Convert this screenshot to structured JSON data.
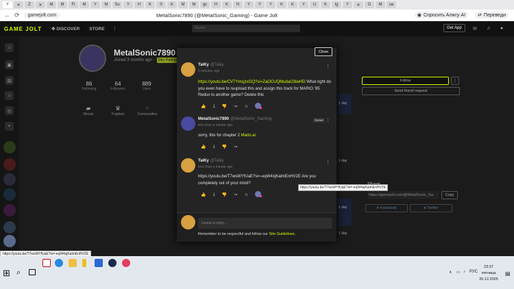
{
  "browser": {
    "tabs": [
      "Y",
      "✕",
      "Z",
      "✕",
      "M",
      "M",
      "Fi",
      "M",
      "Y",
      "M",
      "Su",
      "Y",
      "H",
      "K",
      "S",
      "K",
      "M",
      "M",
      "gc",
      "H",
      "K",
      "N",
      "Y",
      "Y",
      "Y",
      "K",
      "K",
      "Y",
      "U",
      "K",
      "Ig",
      "Y",
      "✕",
      "G",
      "M",
      "ua"
    ],
    "url": "gamejolt.com",
    "page_title": "MetalSonic7890 (@MetalSonic_Gaming) - Game Jolt",
    "alice_label": "Спросить Алису AI",
    "translate_label": "Переведи"
  },
  "site": {
    "logo": "GAME JOLT",
    "nav_discover": "DISCOVER",
    "nav_store": "STORE",
    "search_placeholder": "Search",
    "get_app": "Get App"
  },
  "profile": {
    "name": "MetalSonic7890 @",
    "joined": "Joined 3 months ago ·",
    "badge1": "Dev",
    "badge2": "Partner",
    "stats": [
      {
        "n": "86",
        "l": "Following"
      },
      {
        "n": "64",
        "l": "Followers"
      },
      {
        "n": "889",
        "l": "Likes"
      }
    ],
    "tabs": [
      "Shouts",
      "Trophies",
      "Communities"
    ],
    "follow": "Follow",
    "send_friend": "Send friend request",
    "share_title": "Share",
    "share_url": "https://gamejolt.com/@MetalSonic_Ga",
    "copy": "Copy",
    "facebook": "Facebook",
    "twitter": "Twitter",
    "day1": "1 day",
    "day2": "1 day",
    "day3": "1 day",
    "day4": "1 day"
  },
  "modal": {
    "close": "Close",
    "comments": [
      {
        "name": "TaiKy",
        "handle": "@Taiky",
        "time": "5 minutes ago",
        "link": "https://youtu.be/CV7YmsjzxGQ?si=ZaOCUQMudaO3iwHD",
        "text": " What right do you even have to reupload this and assign this track for MARIO '85 Redux to another game? Delete this",
        "likes": "1"
      },
      {
        "name": "MetalSonic7890",
        "handle": "@MetalSonic_Gaming",
        "owner": "Owner",
        "time": "less than a minute ago",
        "text": "sorry, this for chapter 2 ",
        "link": "Mario.ai",
        "likes": "1"
      },
      {
        "name": "TaiKy",
        "handle": "@Taiky",
        "time": "less than a minute ago",
        "text": "https://youtu.be/T7wsWYfUaE?si=-eqW4xjKalmEnHV2E Are you completely out of your mind?",
        "likes": "1"
      }
    ],
    "reply_placeholder": "Leave a reply...",
    "reply_note": "Remember to be respectful and follow our ",
    "guidelines": "Site Guidelines",
    "reply_note_end": "."
  },
  "tooltip": "https://youtu.be/T7wsWYfUaE?si=-eqW4xjKalmEnHV2E",
  "status_url": "https://youtu.be/T7wsWYfUaE?si=-eqW4xjKalmEnHV2E",
  "taskbar": {
    "lang": "РУС",
    "time": "23:37",
    "weekday": "пятница",
    "date": "26.12.2025"
  }
}
